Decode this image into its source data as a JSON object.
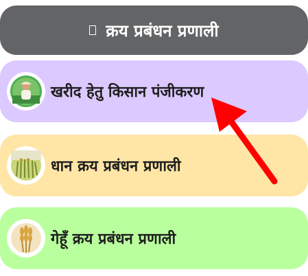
{
  "header": {
    "title": "क्रय प्रबंधन प्रणाली",
    "icon": "document-icon"
  },
  "menu": {
    "items": [
      {
        "label": "खरीद हेतु किसान पंजीकरण",
        "icon": "farmer-icon",
        "bg": "#dbc9ff"
      },
      {
        "label": "धान क्रय प्रबंधन प्रणाली",
        "icon": "paddy-field-icon",
        "bg": "#ffe6a6"
      },
      {
        "label": "गेहूँ क्रय प्रबंधन प्रणाली",
        "icon": "wheat-icon",
        "bg": "#baff9e"
      }
    ]
  },
  "colors": {
    "header_bg": "#636466",
    "arrow": "#ff0000"
  }
}
